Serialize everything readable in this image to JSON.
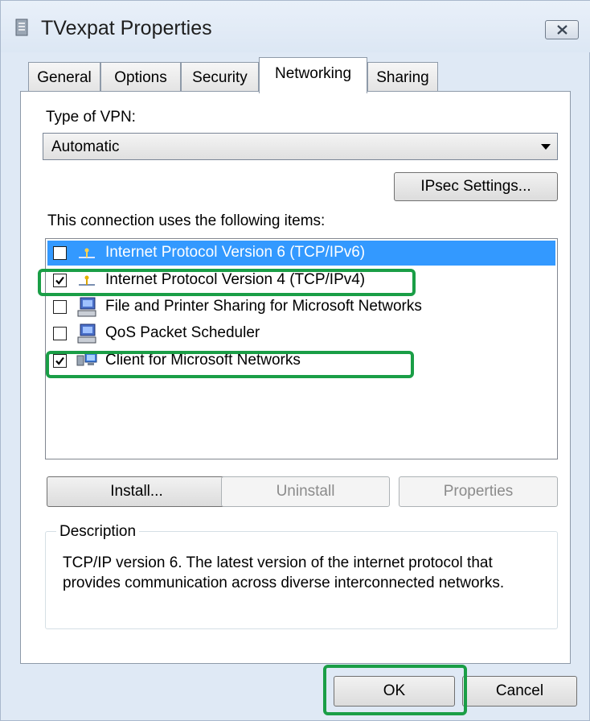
{
  "window": {
    "title": "TVexpat Properties"
  },
  "tabs": [
    {
      "label": "General"
    },
    {
      "label": "Options"
    },
    {
      "label": "Security"
    },
    {
      "label": "Networking"
    },
    {
      "label": "Sharing"
    }
  ],
  "active_tab": "Networking",
  "vpn": {
    "label": "Type of VPN:",
    "value": "Automatic",
    "ipsec_button": "IPsec Settings..."
  },
  "items_list": {
    "label": "This connection uses the following items:",
    "items": [
      {
        "label": "Internet Protocol Version 6 (TCP/IPv6)",
        "checked": false,
        "selected": true,
        "icon": "network-protocol-icon"
      },
      {
        "label": "Internet Protocol Version 4 (TCP/IPv4)",
        "checked": true,
        "selected": false,
        "icon": "network-protocol-icon"
      },
      {
        "label": "File and Printer Sharing for Microsoft Networks",
        "checked": false,
        "selected": false,
        "icon": "network-service-icon"
      },
      {
        "label": "QoS Packet Scheduler",
        "checked": false,
        "selected": false,
        "icon": "network-service-icon"
      },
      {
        "label": "Client for Microsoft Networks",
        "checked": true,
        "selected": false,
        "icon": "network-client-icon"
      }
    ]
  },
  "buttons": {
    "install": "Install...",
    "uninstall": "Uninstall",
    "properties": "Properties"
  },
  "description": {
    "legend": "Description",
    "text": "TCP/IP version 6. The latest version of the internet protocol that provides communication across diverse interconnected networks."
  },
  "footer": {
    "ok": "OK",
    "cancel": "Cancel"
  },
  "colors": {
    "selection": "#3399ff",
    "highlight": "#1a9e46",
    "window_frame": "#dfe9f5"
  }
}
